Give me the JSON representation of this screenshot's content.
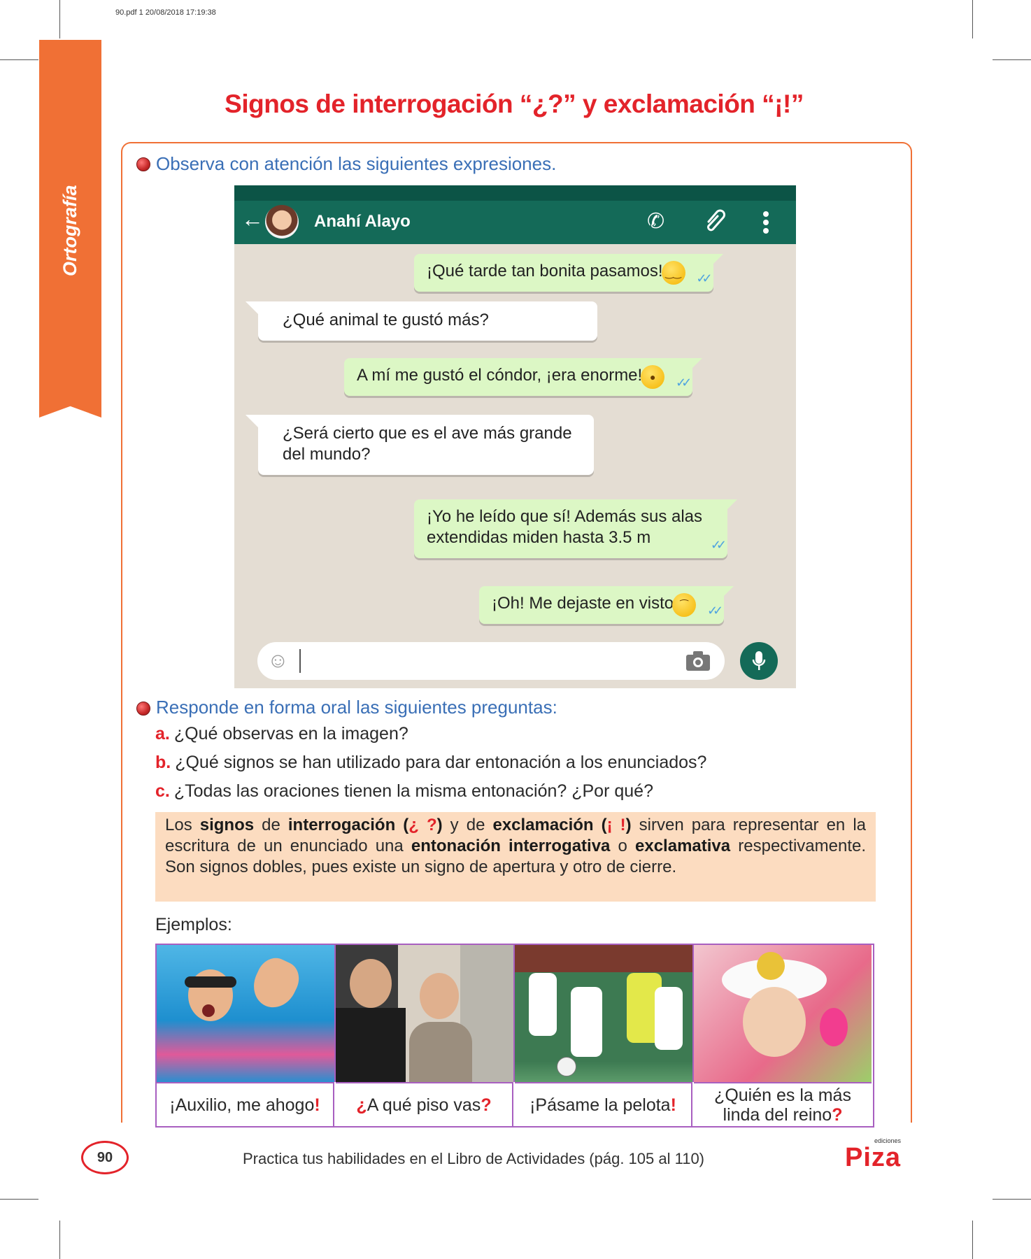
{
  "print_meta": "90.pdf  1  20/08/2018  17:19:38",
  "side_tab": "Ortografía",
  "title": "Signos de interrogación “¿?” y exclamación “¡!”",
  "section1": {
    "instruction": "Observa con atención las siguientes expresiones."
  },
  "chat": {
    "contact_name": "Anahí Alayo",
    "icons": [
      "back-arrow-icon",
      "phone-icon",
      "attach-icon",
      "menu-icon",
      "emoji-icon",
      "camera-icon",
      "mic-icon"
    ],
    "messages": [
      {
        "side": "out",
        "text": "¡Qué tarde tan bonita pasamos!",
        "emoji": "relieved-face"
      },
      {
        "side": "in",
        "text": "¿Qué animal te gustó más?"
      },
      {
        "side": "out",
        "text": "A mí me gustó el cóndor, ¡era enorme!",
        "emoji": "surprised-face"
      },
      {
        "side": "in",
        "text": "¿Será cierto que es el ave más grande del mundo?"
      },
      {
        "side": "out",
        "text": "¡Yo he leído que sí! Además sus alas extendidas miden hasta 3.5 m"
      },
      {
        "side": "out",
        "text": "¡Oh! Me dejaste en visto",
        "emoji": "sad-face"
      }
    ]
  },
  "section2": {
    "instruction": "Responde en forma oral las siguientes preguntas:",
    "questions": [
      {
        "letter": "a.",
        "text": "¿Qué observas en la imagen?"
      },
      {
        "letter": "b.",
        "text": "¿Qué signos se han utilizado para dar entonación a los enunciados?"
      },
      {
        "letter": "c.",
        "text": "¿Todas las oraciones tienen la misma entonación? ¿Por qué?"
      }
    ]
  },
  "rule": {
    "p1": "Los ",
    "b1": "signos",
    "p2": " de ",
    "b2": "interrogación (",
    "r1": "¿ ?",
    "b3": ")",
    "p3": " y de ",
    "b4": "exclamación (",
    "r2": "¡ !",
    "b5": ")",
    "p4": " sirven para representar en la escritura de un enunciado una ",
    "b6": "entonación interrogativa",
    "p5": " o ",
    "b7": "exclamativa",
    "p6": " respectivamente. Son signos dobles, pues existe un signo de apertura y otro de cierre."
  },
  "examples": {
    "label": "Ejemplos:",
    "items": [
      {
        "open": "¡",
        "text": "Auxilio, me ahogo",
        "close": "!"
      },
      {
        "open": "¿",
        "text": "A qué piso vas",
        "close": "?"
      },
      {
        "open": "¡",
        "text": "Pásame la pelota",
        "close": "!"
      },
      {
        "open": "¿",
        "text": "Quién es la más linda del reino",
        "close": "?"
      }
    ]
  },
  "footer": {
    "page_number": "90",
    "text": "Practica tus habilidades en el Libro de Actividades (pág. 105 al 110)",
    "brand_small": "ediciones",
    "brand": "Piza"
  },
  "colors": {
    "accent": "#f07035",
    "title": "#e3232a",
    "instruction": "#3a6fb6",
    "chat_header": "#146a58",
    "out_bubble": "#dcf7c5",
    "rule_bg": "#fcdcc0",
    "grid_border": "#a85fc0"
  }
}
